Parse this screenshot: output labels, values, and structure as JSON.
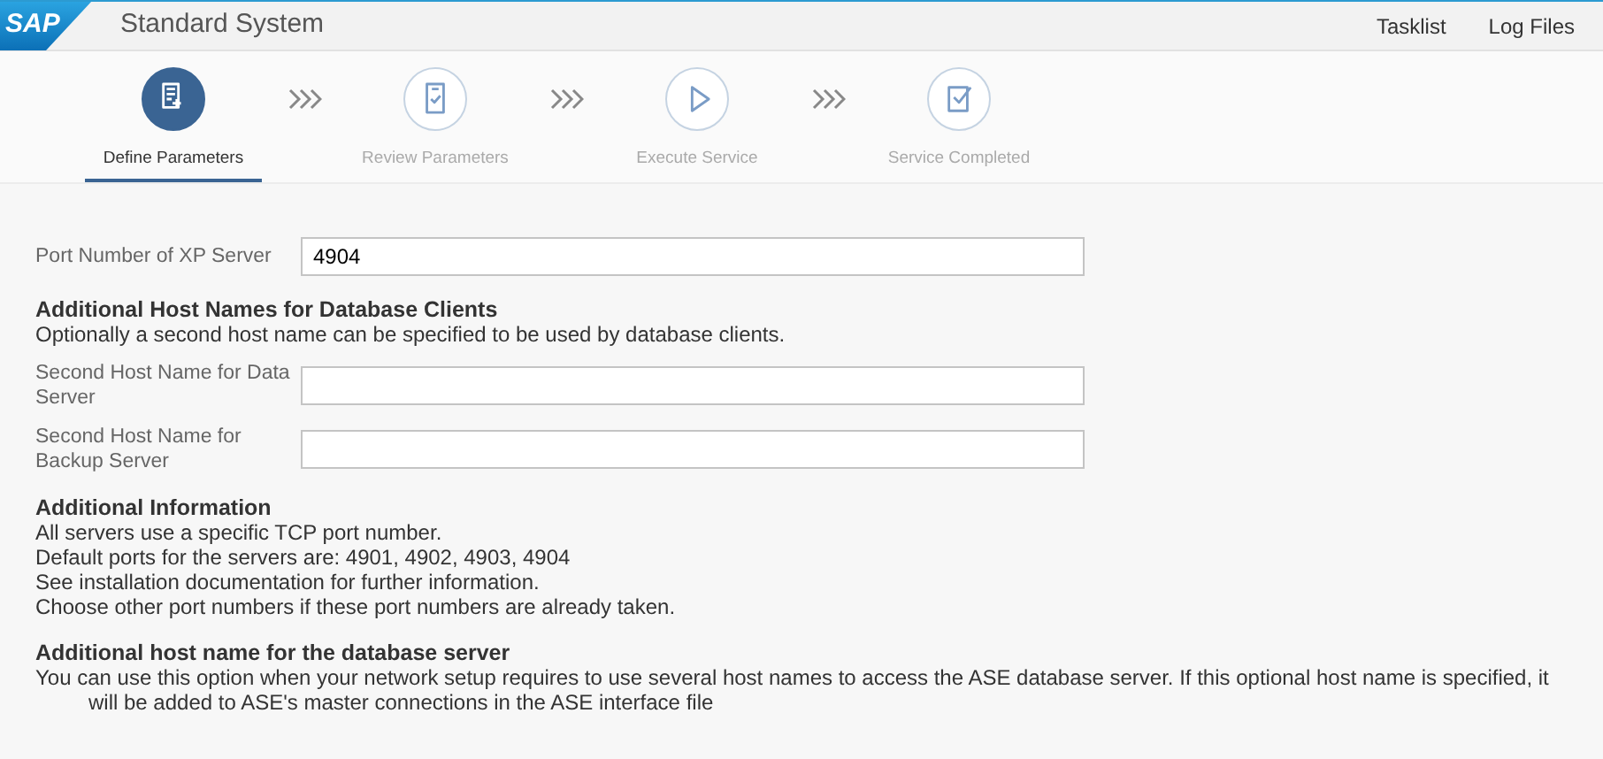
{
  "header": {
    "logo": "SAP",
    "title": "Standard System",
    "links": [
      {
        "label": "Tasklist"
      },
      {
        "label": "Log Files"
      }
    ]
  },
  "steps": [
    {
      "label": "Define Parameters",
      "kind": "form",
      "selected": true
    },
    {
      "label": "Review Parameters",
      "kind": "review",
      "selected": false
    },
    {
      "label": "Execute Service",
      "kind": "play",
      "selected": false
    },
    {
      "label": "Service Completed",
      "kind": "done",
      "selected": false
    }
  ],
  "partial_row": {
    "label": "Port Number of XP Server",
    "value": "4904"
  },
  "sections": [
    {
      "kind": "fields",
      "title": "Additional Host Names for Database Clients",
      "lines": [
        "Optionally a second host name can be specified to be used by database clients."
      ],
      "fields": [
        {
          "label": "Second Host Name for Data Server"
        },
        {
          "label": "Second Host Name for Backup Server"
        }
      ]
    },
    {
      "kind": "info",
      "title": "Additional Information",
      "lines": [
        "All servers use a specific TCP port number.",
        "Default ports for the servers are: 4901, 4902, 4903, 4904",
        "See installation documentation for further information.",
        "Choose other port numbers if these port numbers are already taken."
      ]
    },
    {
      "kind": "info",
      "title": "Additional host name for the database server",
      "lines": [
        "You can use this option when your network setup requires to use several host names to access the ASE database server. If this optional host name is specified, it"
      ],
      "bullets": [
        "will be added to ASE's master connections in the ASE interface file"
      ]
    }
  ]
}
